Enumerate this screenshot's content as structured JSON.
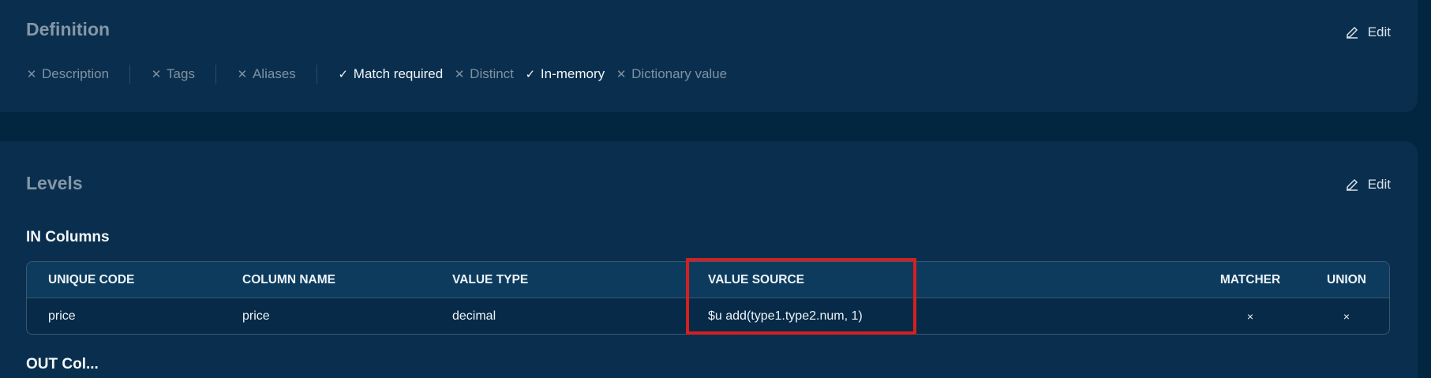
{
  "definition": {
    "title": "Definition",
    "edit_label": "Edit",
    "flags": [
      {
        "label": "Description",
        "state": "off"
      },
      {
        "label": "Tags",
        "state": "off"
      },
      {
        "label": "Aliases",
        "state": "off"
      },
      {
        "label": "Match required",
        "state": "on"
      },
      {
        "label": "Distinct",
        "state": "off"
      },
      {
        "label": "In-memory",
        "state": "on"
      },
      {
        "label": "Dictionary value",
        "state": "off"
      }
    ]
  },
  "levels": {
    "title": "Levels",
    "edit_label": "Edit",
    "in_columns_label": "IN Columns",
    "table": {
      "headers": [
        "UNIQUE CODE",
        "COLUMN NAME",
        "VALUE TYPE",
        "VALUE SOURCE",
        "MATCHER",
        "UNION"
      ],
      "rows": [
        {
          "unique_code": "price",
          "column_name": "price",
          "value_type": "decimal",
          "value_source": "$u add(type1.type2.num, 1)",
          "matcher": "×",
          "union": "×"
        }
      ]
    },
    "out_columns_label": "OUT Col..."
  },
  "colors": {
    "background": "#022640",
    "card": "#0a2f4e",
    "highlight": "#d42020"
  }
}
